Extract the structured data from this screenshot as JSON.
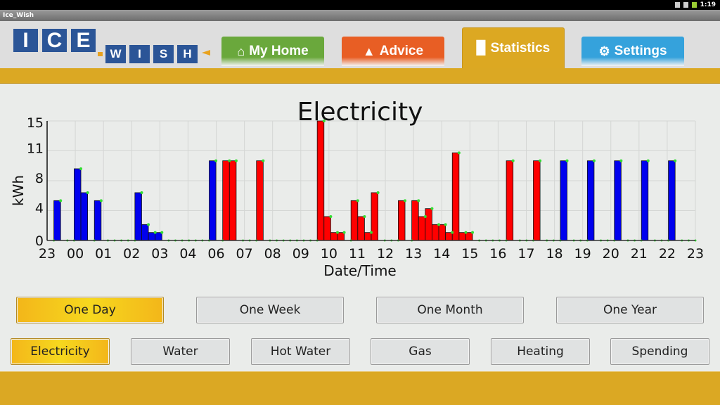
{
  "status_bar": {
    "time": "1:19",
    "icons": [
      "usb-icon",
      "signal-icon",
      "battery-icon"
    ]
  },
  "window_title": "Ice_Wish",
  "logo": {
    "text": "ICE WISH",
    "letters_top": [
      "I",
      "C",
      "E"
    ],
    "letters_bottom": [
      "W",
      "I",
      "S",
      "H"
    ]
  },
  "tabs": [
    {
      "label": "My Home",
      "icon": "home-icon",
      "color": "#6aa83c",
      "active": false
    },
    {
      "label": "Advice",
      "icon": "warning-icon",
      "color": "#e85e24",
      "active": false
    },
    {
      "label": "Statistics",
      "icon": "bar-chart-icon",
      "color": "#dca822",
      "active": true
    },
    {
      "label": "Settings",
      "icon": "gear-icon",
      "color": "#35a2dc",
      "active": false
    }
  ],
  "period_buttons": [
    {
      "label": "One Day",
      "selected": true
    },
    {
      "label": "One Week",
      "selected": false
    },
    {
      "label": "One Month",
      "selected": false
    },
    {
      "label": "One Year",
      "selected": false
    }
  ],
  "resource_buttons": [
    {
      "label": "Electricity",
      "selected": true
    },
    {
      "label": "Water",
      "selected": false
    },
    {
      "label": "Hot Water",
      "selected": false
    },
    {
      "label": "Gas",
      "selected": false
    },
    {
      "label": "Heating",
      "selected": false
    },
    {
      "label": "Spending",
      "selected": false
    }
  ],
  "chart_data": {
    "type": "area",
    "title": "Electricity",
    "xlabel": "Date/Time",
    "ylabel": "kWh",
    "ylim": [
      0,
      15
    ],
    "yticks": [
      0,
      3.75,
      7.5,
      11.25,
      15
    ],
    "ytick_labels": [
      "0",
      "4",
      "8",
      "11",
      "15"
    ],
    "xtick_labels": [
      "23",
      "00",
      "01",
      "02",
      "03",
      "04",
      "06",
      "07",
      "08",
      "09",
      "10",
      "11",
      "12",
      "13",
      "14",
      "15",
      "16",
      "17",
      "18",
      "19",
      "20",
      "21",
      "22",
      "23"
    ],
    "grid": true,
    "interval_minutes": 15,
    "start": "23:00",
    "colors": {
      "blue": "#0000ee",
      "red": "#ff0000",
      "point": "#33dd33"
    },
    "points": [
      {
        "t": "23:15",
        "v": 5,
        "c": "blue"
      },
      {
        "t": "00:00",
        "v": 9,
        "c": "blue"
      },
      {
        "t": "00:15",
        "v": 6,
        "c": "blue"
      },
      {
        "t": "00:45",
        "v": 5,
        "c": "blue"
      },
      {
        "t": "02:15",
        "v": 6,
        "c": "blue"
      },
      {
        "t": "02:30",
        "v": 2,
        "c": "blue"
      },
      {
        "t": "02:45",
        "v": 1,
        "c": "blue"
      },
      {
        "t": "03:00",
        "v": 1,
        "c": "blue"
      },
      {
        "t": "05:00",
        "v": 10,
        "c": "blue"
      },
      {
        "t": "05:30",
        "v": 10,
        "c": "red"
      },
      {
        "t": "05:45",
        "v": 10,
        "c": "red"
      },
      {
        "t": "06:45",
        "v": 10,
        "c": "red"
      },
      {
        "t": "09:00",
        "v": 15,
        "c": "red"
      },
      {
        "t": "09:15",
        "v": 3,
        "c": "red"
      },
      {
        "t": "09:30",
        "v": 1,
        "c": "red"
      },
      {
        "t": "09:45",
        "v": 1,
        "c": "red"
      },
      {
        "t": "10:15",
        "v": 5,
        "c": "red"
      },
      {
        "t": "10:30",
        "v": 3,
        "c": "red"
      },
      {
        "t": "10:45",
        "v": 1,
        "c": "red"
      },
      {
        "t": "11:00",
        "v": 6,
        "c": "red"
      },
      {
        "t": "12:00",
        "v": 5,
        "c": "red"
      },
      {
        "t": "12:30",
        "v": 5,
        "c": "red"
      },
      {
        "t": "12:45",
        "v": 3,
        "c": "red"
      },
      {
        "t": "13:00",
        "v": 4,
        "c": "red"
      },
      {
        "t": "13:15",
        "v": 2,
        "c": "red"
      },
      {
        "t": "13:30",
        "v": 2,
        "c": "red"
      },
      {
        "t": "13:45",
        "v": 1,
        "c": "red"
      },
      {
        "t": "14:00",
        "v": 11,
        "c": "red"
      },
      {
        "t": "14:15",
        "v": 1,
        "c": "red"
      },
      {
        "t": "14:30",
        "v": 1,
        "c": "red"
      },
      {
        "t": "16:00",
        "v": 10,
        "c": "red"
      },
      {
        "t": "17:00",
        "v": 10,
        "c": "red"
      },
      {
        "t": "18:00",
        "v": 10,
        "c": "blue"
      },
      {
        "t": "19:00",
        "v": 10,
        "c": "blue"
      },
      {
        "t": "20:00",
        "v": 10,
        "c": "blue"
      },
      {
        "t": "21:00",
        "v": 10,
        "c": "blue"
      },
      {
        "t": "22:00",
        "v": 10,
        "c": "blue"
      }
    ]
  }
}
